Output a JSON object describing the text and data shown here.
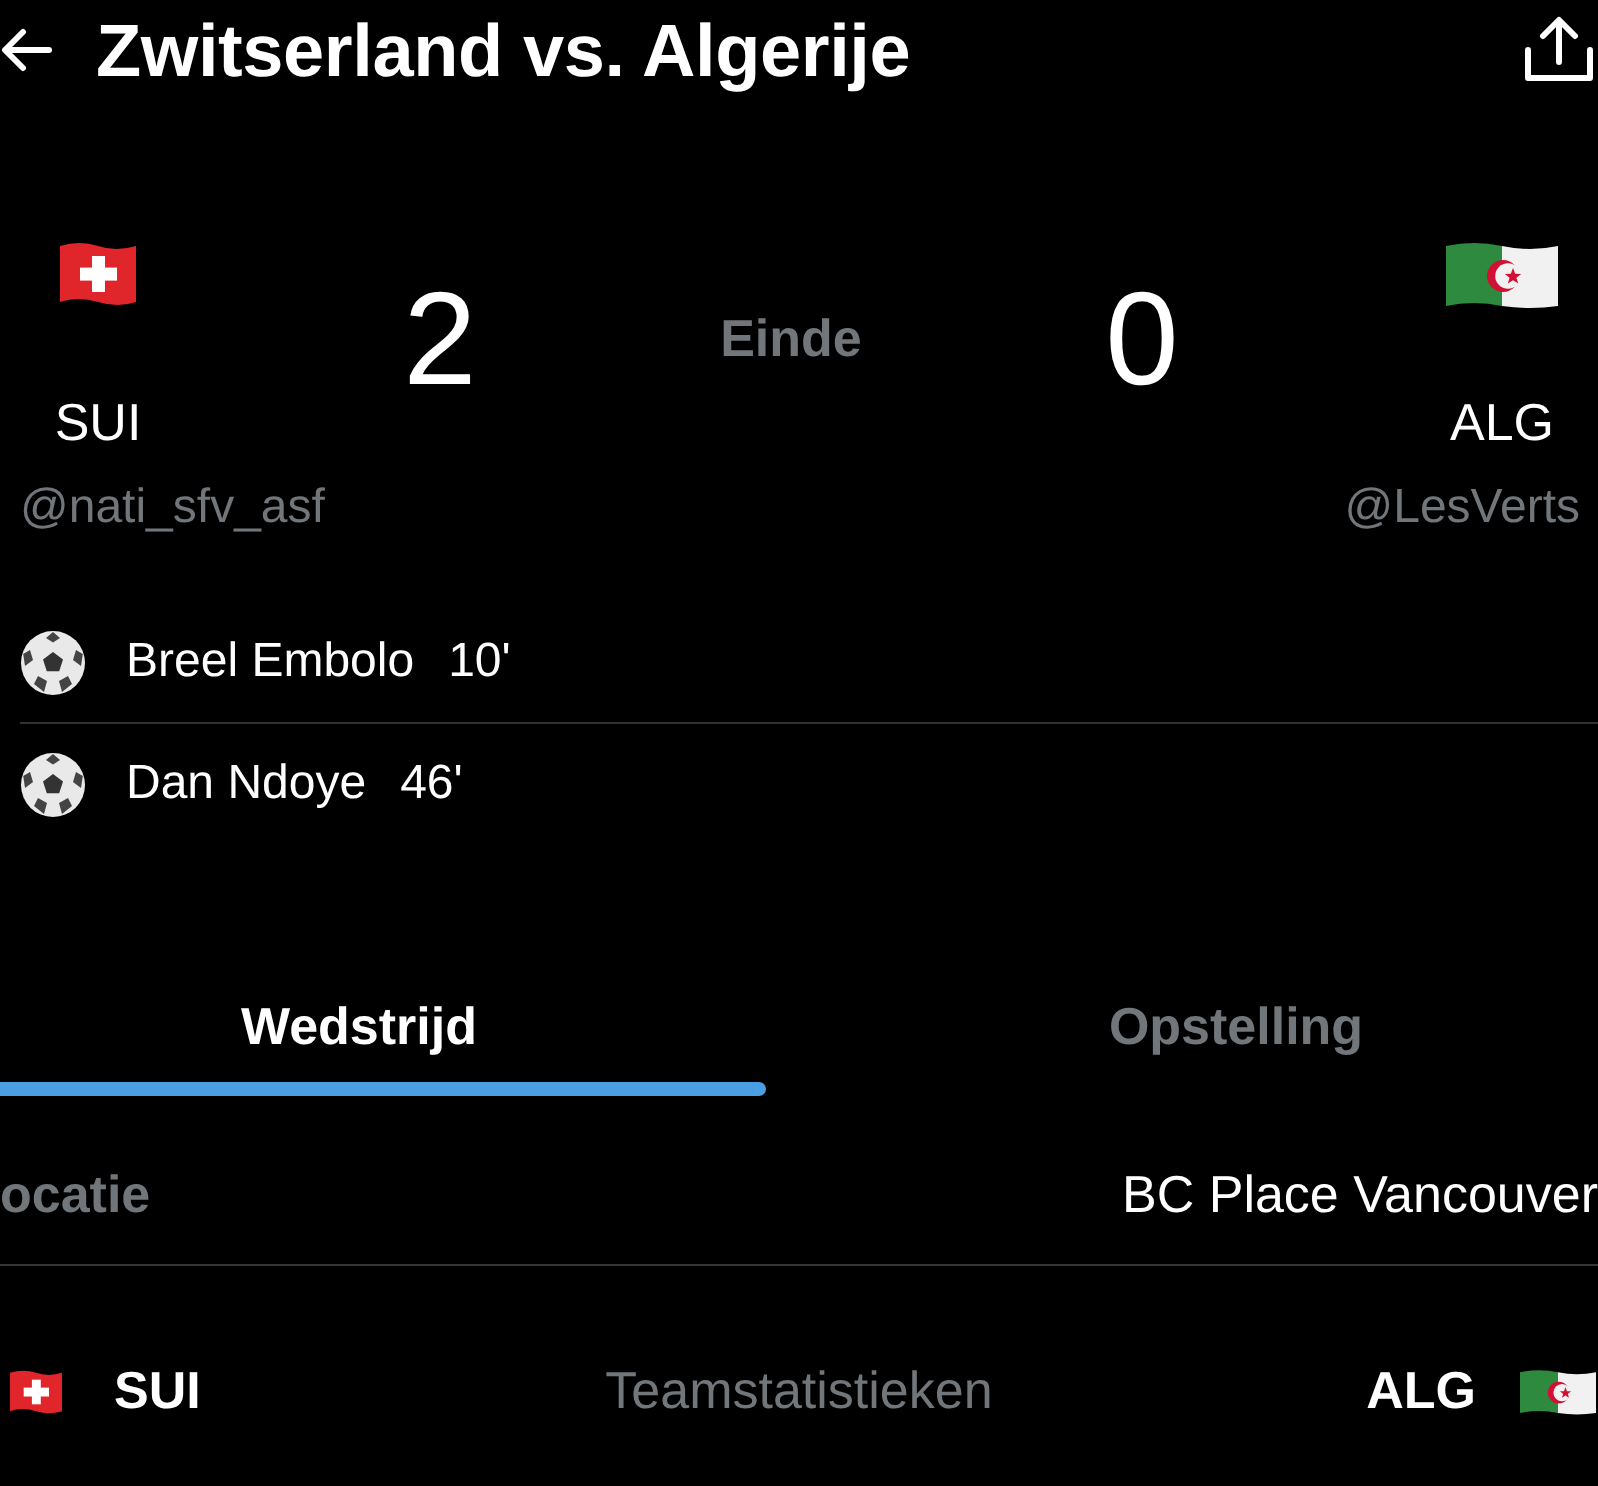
{
  "header": {
    "title": "Zwitserland vs. Algerije"
  },
  "scoreboard": {
    "status": "Einde",
    "teams": [
      {
        "code": "SUI",
        "handle": "@nati_sfv_asf",
        "score": "2"
      },
      {
        "code": "ALG",
        "handle": "@LesVerts",
        "score": "0"
      }
    ]
  },
  "goals": [
    {
      "player": "Breel Embolo",
      "minute": "10'"
    },
    {
      "player": "Dan Ndoye",
      "minute": "46'"
    }
  ],
  "tabs": [
    {
      "label": "Wedstrijd",
      "selected": true
    },
    {
      "label": "Opstelling",
      "selected": false
    }
  ],
  "details": [
    {
      "label": "ocatie",
      "value": "BC Place Vancouver"
    }
  ],
  "team_stats": {
    "title": "Teamstatistieken",
    "teams": [
      {
        "code": "SUI"
      },
      {
        "code": "ALG"
      }
    ]
  }
}
